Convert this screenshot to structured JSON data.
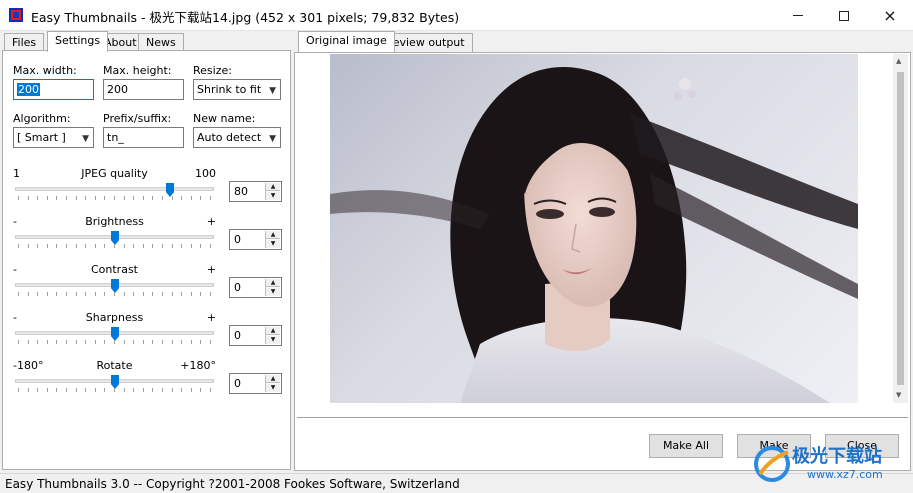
{
  "window": {
    "title": "Easy Thumbnails - 极光下载站14.jpg  (452 x 301 pixels;  79,832 Bytes)",
    "controls": {
      "minimize": "minimize-icon",
      "maximize": "maximize-icon",
      "close": "×"
    }
  },
  "left_tabs": [
    {
      "label": "Files",
      "active": false
    },
    {
      "label": "Settings",
      "active": true
    },
    {
      "label": "About",
      "active": false
    },
    {
      "label": "News",
      "active": false
    }
  ],
  "right_tabs": [
    {
      "label": "Original image",
      "active": true
    },
    {
      "label": "Preview output",
      "active": false
    }
  ],
  "settings": {
    "max_width": {
      "label": "Max. width:",
      "value": "200"
    },
    "max_height": {
      "label": "Max. height:",
      "value": "200"
    },
    "resize": {
      "label": "Resize:",
      "value": "Shrink to fit"
    },
    "algorithm": {
      "label": "Algorithm:",
      "value": "[ Smart ]"
    },
    "prefix": {
      "label": "Prefix/suffix:",
      "value": "tn_"
    },
    "new_name": {
      "label": "New name:",
      "value": "Auto detect"
    },
    "jpeg_quality": {
      "label": "JPEG quality",
      "min": "1",
      "max": "100",
      "value": "80",
      "fraction": 0.79
    },
    "brightness": {
      "label": "Brightness",
      "min": "-",
      "max": "+",
      "value": "0",
      "fraction": 0.5
    },
    "contrast": {
      "label": "Contrast",
      "min": "-",
      "max": "+",
      "value": "0",
      "fraction": 0.5
    },
    "sharpness": {
      "label": "Sharpness",
      "min": "-",
      "max": "+",
      "value": "0",
      "fraction": 0.5
    },
    "rotate": {
      "label": "Rotate",
      "min": "-180°",
      "max": "+180°",
      "value": "0",
      "fraction": 0.5
    }
  },
  "buttons": {
    "make_all": "Make All",
    "make": "Make",
    "close": "Close"
  },
  "status": "Easy Thumbnails 3.0 -- Copyright ?2001-2008 Fookes Software, Switzerland",
  "watermark": {
    "text": "极光下载站",
    "url": "www.xz7.com"
  }
}
